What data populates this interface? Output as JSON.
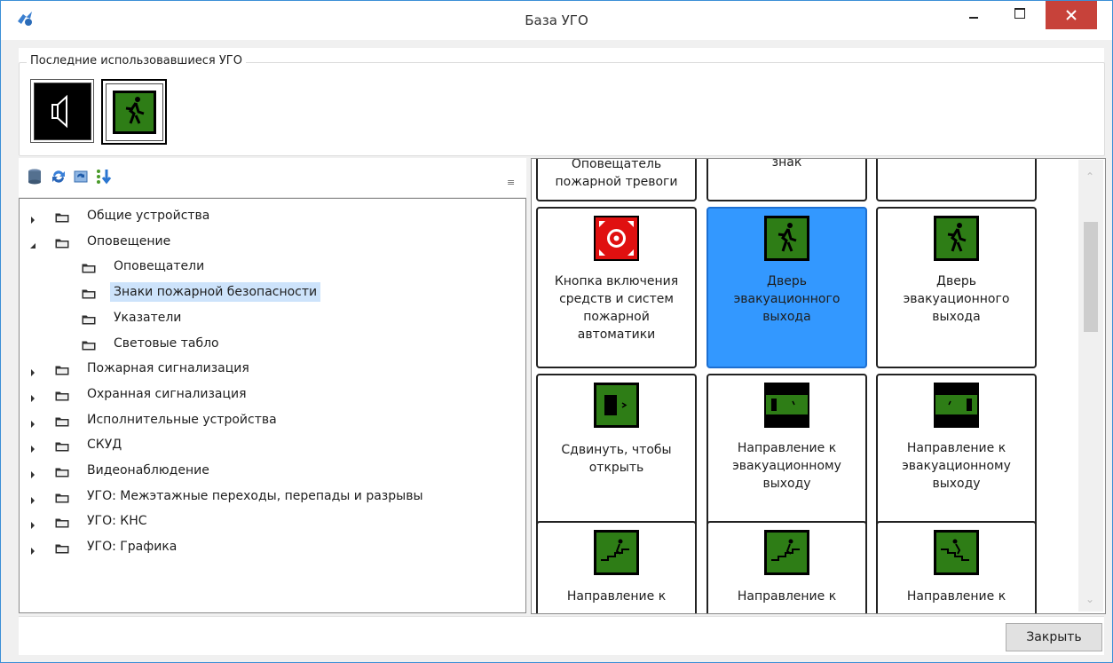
{
  "window": {
    "title": "База УГО",
    "buttons": {
      "minimize": "minimize",
      "maximize": "maximize",
      "close": "close"
    }
  },
  "recent": {
    "legend": "Последние использовавшиеся УГО",
    "items": [
      {
        "icon": "speaker-icon",
        "selected": false
      },
      {
        "icon": "exit-door-icon",
        "selected": true
      }
    ]
  },
  "toolbar": {
    "icons": [
      "database-icon",
      "refresh-icon",
      "sync-icon",
      "sort-icon"
    ]
  },
  "tree": {
    "items": [
      {
        "label": "Общие устройства",
        "expander": "collapsed",
        "level": 0
      },
      {
        "label": "Оповещение",
        "expander": "expanded",
        "level": 0
      },
      {
        "label": "Оповещатели",
        "expander": "none",
        "level": 1
      },
      {
        "label": "Знаки пожарной безопасности",
        "expander": "none",
        "level": 1,
        "selected": true
      },
      {
        "label": "Указатели",
        "expander": "none",
        "level": 1
      },
      {
        "label": "Световые табло",
        "expander": "none",
        "level": 1
      },
      {
        "label": "Пожарная сигнализация",
        "expander": "collapsed",
        "level": 0
      },
      {
        "label": "Охранная сигнализация",
        "expander": "collapsed",
        "level": 0
      },
      {
        "label": "Исполнительные устройства",
        "expander": "collapsed",
        "level": 0
      },
      {
        "label": "СКУД",
        "expander": "collapsed",
        "level": 0
      },
      {
        "label": "Видеонаблюдение",
        "expander": "collapsed",
        "level": 0
      },
      {
        "label": "УГО: Межэтажные переходы, перепады и разрывы",
        "expander": "collapsed",
        "level": 0
      },
      {
        "label": "УГО: КНС",
        "expander": "collapsed",
        "level": 0
      },
      {
        "label": "УГО: Графика",
        "expander": "collapsed",
        "level": 0
      }
    ]
  },
  "grid": {
    "tiles": [
      {
        "caption": [
          "Оповещатель",
          "пожарной тревоги"
        ],
        "icon": "none"
      },
      {
        "caption": [
          "знак"
        ],
        "icon": "none"
      },
      {
        "caption": [],
        "icon": "none"
      },
      {
        "caption": [
          "Кнопка включения",
          "средств и систем",
          "пожарной",
          "автоматики"
        ],
        "icon": "fire-button-icon"
      },
      {
        "caption": [
          "Дверь",
          "эвакуационного",
          "выхода"
        ],
        "icon": "exit-door-icon",
        "selected": true
      },
      {
        "caption": [
          "Дверь",
          "эвакуационного",
          "выхода"
        ],
        "icon": "exit-door-icon"
      },
      {
        "caption": [
          "Сдвинуть, чтобы",
          "открыть"
        ],
        "icon": "slide-open-icon"
      },
      {
        "caption": [
          "Направление к",
          "эвакуационному",
          "выходу"
        ],
        "icon": "exit-direction-right-icon"
      },
      {
        "caption": [
          "Направление к",
          "эвакуационному",
          "выходу"
        ],
        "icon": "exit-direction-left-icon"
      },
      {
        "caption": [
          "Направление к"
        ],
        "icon": "stairs-down-icon"
      },
      {
        "caption": [
          "Направление к"
        ],
        "icon": "stairs-down-icon"
      },
      {
        "caption": [
          "Направление к"
        ],
        "icon": "stairs-up-icon"
      }
    ]
  },
  "footer": {
    "close_label": "Закрыть"
  },
  "colors": {
    "accent_selected": "#3398ff",
    "close_red": "#c7423a",
    "sign_green": "#2e7d16",
    "alarm_red": "#e01010"
  }
}
